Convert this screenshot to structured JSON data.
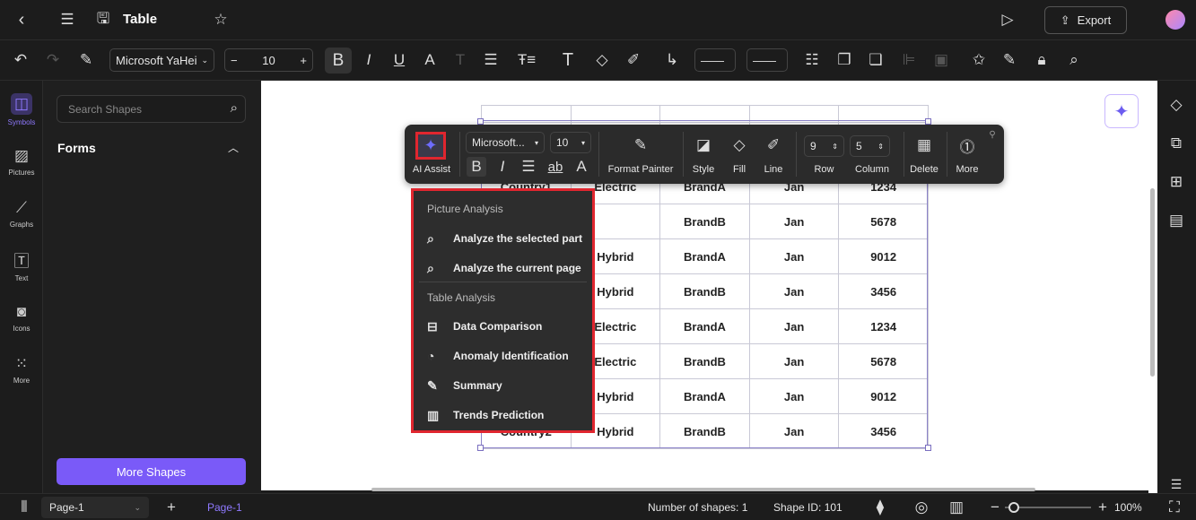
{
  "app": {
    "title": "Table",
    "export_label": "Export"
  },
  "toolbar": {
    "font": "Microsoft YaHei",
    "size": "10"
  },
  "rail": [
    {
      "label": "Symbols",
      "icon": "symbols-icon"
    },
    {
      "label": "Pictures",
      "icon": "picture-icon"
    },
    {
      "label": "Graphs",
      "icon": "graph-icon"
    },
    {
      "label": "Text",
      "icon": "text-icon"
    },
    {
      "label": "Icons",
      "icon": "icons-icon"
    },
    {
      "label": "More",
      "icon": "grid-icon"
    }
  ],
  "panel": {
    "search_placeholder": "Search Shapes",
    "section": "Forms",
    "more_shapes": "More Shapes"
  },
  "float_toolbar": {
    "ai_assist": "AI Assist",
    "font": "Microsoft...",
    "size": "10",
    "format_painter": "Format Painter",
    "style": "Style",
    "fill": "Fill",
    "line": "Line",
    "row_value": "9",
    "row": "Row",
    "col_value": "5",
    "column": "Column",
    "delete": "Delete",
    "more": "More"
  },
  "ai_menu": {
    "picture_header": "Picture Analysis",
    "picture_items": [
      "Analyze the selected part",
      "Analyze the current page"
    ],
    "table_header": "Table Analysis",
    "table_items": [
      "Data Comparison",
      "Anomaly Identification",
      "Summary",
      "Trends Prediction"
    ]
  },
  "table": {
    "rows": [
      [
        "",
        "",
        "",
        "",
        ""
      ],
      [
        "",
        "",
        "",
        "",
        ""
      ],
      [
        "Country1",
        "Electric",
        "BrandA",
        "Jan",
        "1234"
      ],
      [
        "",
        "",
        "BrandB",
        "Jan",
        "5678"
      ],
      [
        "",
        "Hybrid",
        "BrandA",
        "Jan",
        "9012"
      ],
      [
        "",
        "Hybrid",
        "BrandB",
        "Jan",
        "3456"
      ],
      [
        "",
        "Electric",
        "BrandA",
        "Jan",
        "1234"
      ],
      [
        "",
        "Electric",
        "BrandB",
        "Jan",
        "5678"
      ],
      [
        "",
        "Hybrid",
        "BrandA",
        "Jan",
        "9012"
      ],
      [
        "Country2",
        "Hybrid",
        "BrandB",
        "Jan",
        "3456"
      ]
    ]
  },
  "bottom": {
    "page_select": "Page-1",
    "page_tab": "Page-1",
    "shapes": "Number of shapes: 1",
    "shape_id": "Shape ID: 101",
    "zoom": "100%"
  },
  "colors": {
    "accent": "#7a5af8",
    "highlight": "#e0262f"
  }
}
